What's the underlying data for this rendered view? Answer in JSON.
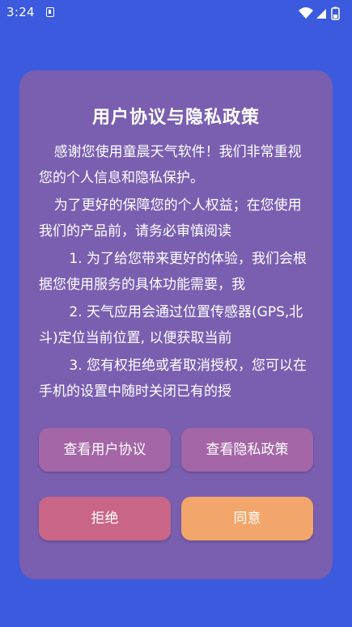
{
  "status_bar": {
    "time": "3:24",
    "icons": [
      "notification-a-icon",
      "wifi-icon",
      "signal-icon",
      "battery-icon"
    ]
  },
  "dialog": {
    "title": "用户协议与隐私政策",
    "paragraphs": [
      "感谢您使用童晨天气软件！我们非常重视您的个人信息和隐私保护。",
      "为了更好的保障您的个人权益；在您使用我们的产品前，请务必审慎阅读",
      "1. 为了给您带来更好的体验，我们会根据您使用服务的具体功能需要，我",
      "2. 天气应用会通过位置传感器(GPS,北斗)定位当前位置, 以便获取当前",
      "3. 您有权拒绝或者取消授权，您可以在手机的设置中随时关闭已有的授"
    ],
    "buttons": {
      "view_agreement": "查看用户协议",
      "view_privacy": "查看隐私政策",
      "reject": "拒绝",
      "agree": "同意"
    }
  },
  "colors": {
    "background": "#3c5ade",
    "dialog": "#7a5fb0",
    "secondary_button": "#a466a6",
    "reject_button": "#c96688",
    "agree_button": "#f3a66b"
  }
}
